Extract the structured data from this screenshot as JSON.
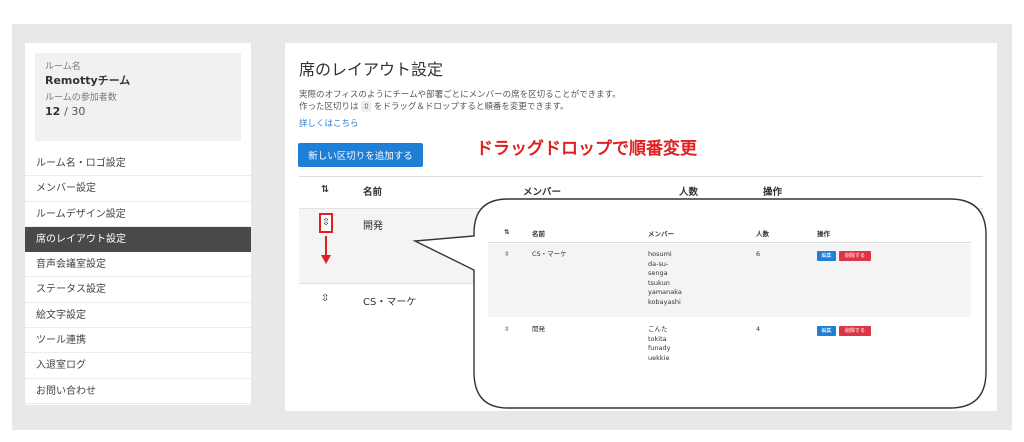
{
  "sidebar": {
    "room_label": "ルーム名",
    "room_name": "Remottyチーム",
    "members_label": "ルームの参加者数",
    "members_count": "12",
    "members_max": "/ 30",
    "items": [
      {
        "label": "ルーム名・ロゴ設定",
        "active": false
      },
      {
        "label": "メンバー設定",
        "active": false
      },
      {
        "label": "ルームデザイン設定",
        "active": false
      },
      {
        "label": "席のレイアウト設定",
        "active": true
      },
      {
        "label": "音声会議室設定",
        "active": false
      },
      {
        "label": "ステータス設定",
        "active": false
      },
      {
        "label": "絵文字設定",
        "active": false
      },
      {
        "label": "ツール連携",
        "active": false
      },
      {
        "label": "入退室ログ",
        "active": false
      },
      {
        "label": "お問い合わせ",
        "active": false
      }
    ]
  },
  "main": {
    "title": "席のレイアウト設定",
    "desc_line1": "実際のオフィスのようにチームや部署ごとにメンバーの席を区切ることができます。",
    "desc_line2_pre": "作った区切りは",
    "desc_line2_post": "をドラッグ＆ドロップすると順番を変更できます。",
    "more_link": "詳しくはこちら",
    "add_button": "新しい区切りを追加する",
    "annotation": "ドラッグドロップで順番変更",
    "columns": {
      "sort": "⇅",
      "name": "名前",
      "members": "メンバー",
      "count": "人数",
      "action": "操作"
    },
    "rows": [
      {
        "name": "開発"
      },
      {
        "name": "CS・マーケ"
      }
    ]
  },
  "zoom": {
    "columns": {
      "sort": "⇅",
      "name": "名前",
      "members": "メンバー",
      "count": "人数",
      "action": "操作"
    },
    "rows": [
      {
        "name": "CS・マーケ",
        "members": [
          "hosumi",
          "da-su-",
          "senga",
          "tsukun",
          "yamanaka",
          "kobayashi"
        ],
        "count": "6",
        "edit": "編集",
        "delete": "削除する"
      },
      {
        "name": "開発",
        "members": [
          "こんた",
          "tokita",
          "funady",
          "uekkie"
        ],
        "count": "4",
        "edit": "編集",
        "delete": "削除する"
      }
    ]
  },
  "icons": {
    "grip": "drag-handle-icon",
    "grip_glyph": "⇳"
  },
  "colors": {
    "accent": "#1f7ed6",
    "annotation": "#e02020",
    "danger": "#dc3545",
    "active_nav": "#494949"
  }
}
